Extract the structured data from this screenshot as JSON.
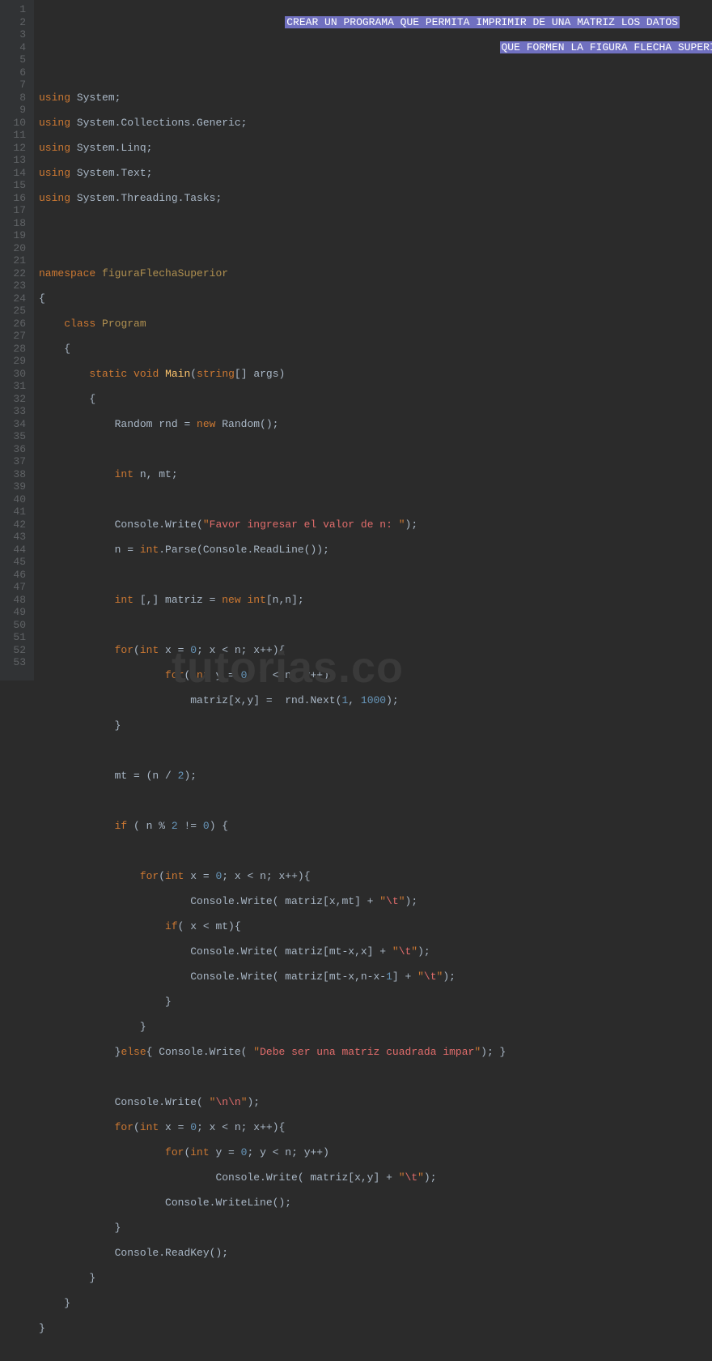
{
  "watermark": "tutorias.co",
  "gutter": {
    "start": 1,
    "end": 53
  },
  "lines": {
    "l1": {
      "indent": "                                       ",
      "sel": "CREAR UN PROGRAMA QUE PERMITA IMPRIMIR DE UNA MATRIZ LOS DATOS"
    },
    "l2": {
      "indent": "                                                                         ",
      "sel": "QUE FORMEN LA FIGURA FLECHA SUPERIOR"
    },
    "l4": {
      "kw": "using",
      "sp": " ",
      "t": "System;"
    },
    "l5": {
      "kw": "using",
      "sp": " ",
      "t": "System.Collections.Generic;"
    },
    "l6": {
      "kw": "using",
      "sp": " ",
      "t": "System.Linq;"
    },
    "l7": {
      "kw": "using",
      "sp": " ",
      "t": "System.Text;"
    },
    "l8": {
      "kw": "using",
      "sp": " ",
      "t": "System.Threading.Tasks;"
    },
    "l11": {
      "kw": "namespace",
      "sp": " ",
      "ns": "figuraFlechaSuperior"
    },
    "l12": {
      "t": "{"
    },
    "l13": {
      "ind": "    ",
      "kw": "class",
      "sp": " ",
      "cls": "Program"
    },
    "l14": {
      "ind": "    ",
      "t": "{"
    },
    "l15": {
      "ind": "        ",
      "kw1": "static",
      "sp1": " ",
      "kw2": "void",
      "sp2": " ",
      "m": "Main",
      "p1": "(",
      "kw3": "string",
      "br": "[] ",
      "arg": "args)"
    },
    "l16": {
      "ind": "        ",
      "t": "{"
    },
    "l17": {
      "ind": "            ",
      "t1": "Random rnd = ",
      "kw": "new",
      "t2": " Random();"
    },
    "l19": {
      "ind": "            ",
      "kw": "int",
      "t": " n, mt;"
    },
    "l21": {
      "ind": "            ",
      "t1": "Console.Write(",
      "q1": "\"",
      "s": "Favor ingresar el valor de n: ",
      "q2": "\"",
      "t2": ");"
    },
    "l22": {
      "ind": "            ",
      "t1": "n = ",
      "kw": "int",
      "t2": ".Parse(Console.ReadLine());"
    },
    "l24": {
      "ind": "            ",
      "kw1": "int",
      "t1": " [,] matriz = ",
      "kw2": "new",
      "sp": " ",
      "kw3": "int",
      "t2": "[n,n];"
    },
    "l26": {
      "ind": "            ",
      "kw1": "for",
      "p": "(",
      "kw2": "int",
      "t1": " x = ",
      "n1": "0",
      "t2": "; x < n; x++){"
    },
    "l27": {
      "ind": "                    ",
      "kw1": "for",
      "p": "(",
      "kw2": "int",
      "t1": " y = ",
      "n1": "0",
      "t2": "; y < n; y++)"
    },
    "l28": {
      "ind": "                        ",
      "t1": "matriz[x,y] =  rnd.Next(",
      "n1": "1",
      "c": ", ",
      "n2": "1000",
      "t2": ");"
    },
    "l29": {
      "ind": "            ",
      "t": "}"
    },
    "l31": {
      "ind": "            ",
      "t1": "mt = (n / ",
      "n": "2",
      "t2": ");"
    },
    "l33": {
      "ind": "            ",
      "kw": "if",
      "t1": " ( n % ",
      "n1": "2",
      "t2": " != ",
      "n2": "0",
      "t3": ") {"
    },
    "l35": {
      "ind": "                ",
      "kw1": "for",
      "p": "(",
      "kw2": "int",
      "t1": " x = ",
      "n1": "0",
      "t2": "; x < n; x++){"
    },
    "l36": {
      "ind": "                        ",
      "t1": "Console.Write( matriz[x,mt] + ",
      "q1": "\"",
      "s": "\\t",
      "q2": "\"",
      "t2": ");"
    },
    "l37": {
      "ind": "                    ",
      "kw": "if",
      "t": "( x < mt){"
    },
    "l38": {
      "ind": "                        ",
      "t1": "Console.Write( matriz[mt-x,x] + ",
      "q1": "\"",
      "s": "\\t",
      "q2": "\"",
      "t2": ");"
    },
    "l39": {
      "ind": "                        ",
      "t1": "Console.Write( matriz[mt-x,n-x-",
      "n": "1",
      "t2": "] + ",
      "q1": "\"",
      "s": "\\t",
      "q2": "\"",
      "t3": ");"
    },
    "l40": {
      "ind": "                    ",
      "t": "}"
    },
    "l41": {
      "ind": "                ",
      "t": "}"
    },
    "l42": {
      "ind": "            ",
      "t1": "}",
      "kw": "else",
      "t2": "{ Console.Write( ",
      "q1": "\"",
      "s": "Debe ser una matriz cuadrada impar",
      "q2": "\"",
      "t3": "); }"
    },
    "l44": {
      "ind": "            ",
      "t1": "Console.Write( ",
      "q1": "\"",
      "s": "\\n\\n",
      "q2": "\"",
      "t2": ");"
    },
    "l45": {
      "ind": "            ",
      "kw1": "for",
      "p": "(",
      "kw2": "int",
      "t1": " x = ",
      "n1": "0",
      "t2": "; x < n; x++){"
    },
    "l46": {
      "ind": "                    ",
      "kw1": "for",
      "p": "(",
      "kw2": "int",
      "t1": " y = ",
      "n1": "0",
      "t2": "; y < n; y++)"
    },
    "l47": {
      "ind": "                            ",
      "t1": "Console.Write( matriz[x,y] + ",
      "q1": "\"",
      "s": "\\t",
      "q2": "\"",
      "t2": ");"
    },
    "l48": {
      "ind": "                    ",
      "t": "Console.WriteLine();"
    },
    "l49": {
      "ind": "            ",
      "t": "}"
    },
    "l50": {
      "ind": "            ",
      "t": "Console.ReadKey();"
    },
    "l51": {
      "ind": "        ",
      "t": "}"
    },
    "l52": {
      "ind": "    ",
      "t": "}"
    },
    "l53": {
      "t": "}"
    }
  }
}
